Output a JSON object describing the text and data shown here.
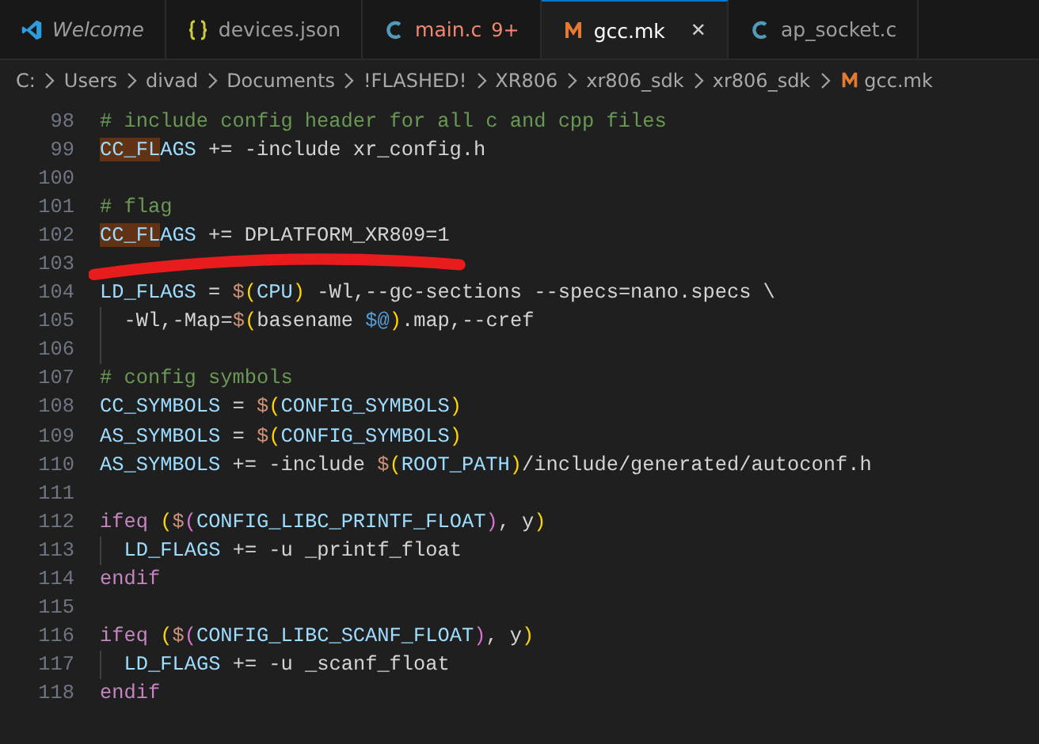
{
  "tabs": [
    {
      "label": "Welcome",
      "kind": "vscode",
      "selected": false,
      "italic": true,
      "error": false
    },
    {
      "label": "devices.json",
      "kind": "json",
      "selected": false,
      "italic": false,
      "error": false
    },
    {
      "label": "main.c",
      "kind": "c",
      "selected": false,
      "italic": false,
      "error": true,
      "badge": "9+"
    },
    {
      "label": "gcc.mk",
      "kind": "make",
      "selected": true,
      "italic": false,
      "error": false,
      "close": "✕"
    },
    {
      "label": "ap_socket.c",
      "kind": "c",
      "selected": false,
      "italic": false,
      "error": false
    }
  ],
  "breadcrumb": [
    {
      "label": "C:"
    },
    {
      "label": "Users"
    },
    {
      "label": "divad"
    },
    {
      "label": "Documents"
    },
    {
      "label": "!FLASHED!"
    },
    {
      "label": "XR806"
    },
    {
      "label": "xr806_sdk"
    },
    {
      "label": "xr806_sdk"
    },
    {
      "label": "gcc.mk",
      "kind": "make"
    }
  ],
  "lines": [
    {
      "number": "98",
      "guide": false,
      "tokens": [
        {
          "kind": "comment",
          "text": "# include config header for all c and cpp files"
        }
      ]
    },
    {
      "number": "99",
      "guide": false,
      "tokens": [
        {
          "kind": "match",
          "text": "CC_FL"
        },
        {
          "kind": "var",
          "text": "AGS"
        },
        {
          "kind": "text",
          "text": " += -include xr_config.h"
        }
      ]
    },
    {
      "number": "100",
      "guide": false
    },
    {
      "number": "101",
      "guide": false,
      "tokens": [
        {
          "kind": "comment",
          "text": "# flag"
        }
      ]
    },
    {
      "number": "102",
      "guide": false,
      "tokens": [
        {
          "kind": "match",
          "text": "CC_FL"
        },
        {
          "kind": "var",
          "text": "AGS"
        },
        {
          "kind": "text",
          "text": " += DPLATFORM_XR809=1"
        }
      ]
    },
    {
      "number": "103",
      "guide": false
    },
    {
      "number": "104",
      "guide": false,
      "tokens": [
        {
          "kind": "var",
          "text": "LD_FLAGS"
        },
        {
          "kind": "text",
          "text": " = "
        },
        {
          "kind": "dollar",
          "text": "$"
        },
        {
          "kind": "paren1",
          "text": "("
        },
        {
          "kind": "var",
          "text": "CPU"
        },
        {
          "kind": "paren1",
          "text": ")"
        },
        {
          "kind": "text",
          "text": " -Wl,--gc-sections --specs=nano.specs \\"
        }
      ]
    },
    {
      "number": "105",
      "guide": true,
      "tokens": [
        {
          "kind": "text",
          "text": "-Wl,-Map="
        },
        {
          "kind": "dollar",
          "text": "$"
        },
        {
          "kind": "paren1",
          "text": "("
        },
        {
          "kind": "text",
          "text": "basename "
        },
        {
          "kind": "auto",
          "text": "$@"
        },
        {
          "kind": "paren1",
          "text": ")"
        },
        {
          "kind": "text",
          "text": ".map,--cref"
        }
      ]
    },
    {
      "number": "106",
      "guide": true
    },
    {
      "number": "107",
      "guide": false,
      "tokens": [
        {
          "kind": "comment",
          "text": "# config symbols"
        }
      ]
    },
    {
      "number": "108",
      "guide": false,
      "tokens": [
        {
          "kind": "var",
          "text": "CC_SYMBOLS"
        },
        {
          "kind": "text",
          "text": " = "
        },
        {
          "kind": "dollar",
          "text": "$"
        },
        {
          "kind": "paren1",
          "text": "("
        },
        {
          "kind": "var",
          "text": "CONFIG_SYMBOLS"
        },
        {
          "kind": "paren1",
          "text": ")"
        }
      ]
    },
    {
      "number": "109",
      "guide": false,
      "tokens": [
        {
          "kind": "var",
          "text": "AS_SYMBOLS"
        },
        {
          "kind": "text",
          "text": " = "
        },
        {
          "kind": "dollar",
          "text": "$"
        },
        {
          "kind": "paren1",
          "text": "("
        },
        {
          "kind": "var",
          "text": "CONFIG_SYMBOLS"
        },
        {
          "kind": "paren1",
          "text": ")"
        }
      ]
    },
    {
      "number": "110",
      "guide": false,
      "tokens": [
        {
          "kind": "var",
          "text": "AS_SYMBOLS"
        },
        {
          "kind": "text",
          "text": " += -include "
        },
        {
          "kind": "dollar",
          "text": "$"
        },
        {
          "kind": "paren1",
          "text": "("
        },
        {
          "kind": "var",
          "text": "ROOT_PATH"
        },
        {
          "kind": "paren1",
          "text": ")"
        },
        {
          "kind": "text",
          "text": "/include/generated/autoconf.h"
        }
      ]
    },
    {
      "number": "111",
      "guide": false
    },
    {
      "number": "112",
      "guide": false,
      "tokens": [
        {
          "kind": "keyword",
          "text": "ifeq "
        },
        {
          "kind": "paren1",
          "text": "("
        },
        {
          "kind": "dollar",
          "text": "$"
        },
        {
          "kind": "paren2",
          "text": "("
        },
        {
          "kind": "var",
          "text": "CONFIG_LIBC_PRINTF_FLOAT"
        },
        {
          "kind": "paren2",
          "text": ")"
        },
        {
          "kind": "text",
          "text": ", y"
        },
        {
          "kind": "paren1",
          "text": ")"
        }
      ]
    },
    {
      "number": "113",
      "guide": true,
      "tokens": [
        {
          "kind": "var",
          "text": "LD_FLAGS"
        },
        {
          "kind": "text",
          "text": " += -u _printf_float"
        }
      ]
    },
    {
      "number": "114",
      "guide": false,
      "tokens": [
        {
          "kind": "keyword",
          "text": "endif"
        }
      ]
    },
    {
      "number": "115",
      "guide": false
    },
    {
      "number": "116",
      "guide": false,
      "tokens": [
        {
          "kind": "keyword",
          "text": "ifeq "
        },
        {
          "kind": "paren1",
          "text": "("
        },
        {
          "kind": "dollar",
          "text": "$"
        },
        {
          "kind": "paren2",
          "text": "("
        },
        {
          "kind": "var",
          "text": "CONFIG_LIBC_SCANF_FLOAT"
        },
        {
          "kind": "paren2",
          "text": ")"
        },
        {
          "kind": "text",
          "text": ", y"
        },
        {
          "kind": "paren1",
          "text": ")"
        }
      ]
    },
    {
      "number": "117",
      "guide": true,
      "tokens": [
        {
          "kind": "var",
          "text": "LD_FLAGS"
        },
        {
          "kind": "text",
          "text": " += -u _scanf_float"
        }
      ]
    },
    {
      "number": "118",
      "guide": false,
      "tokens": [
        {
          "kind": "keyword",
          "text": "endif"
        }
      ]
    }
  ]
}
